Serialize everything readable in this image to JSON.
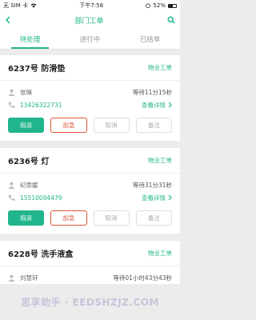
{
  "status_bar": {
    "carrier": "无 SIM 卡",
    "time": "下午7:58",
    "battery": "52%"
  },
  "nav": {
    "title": "部门工单"
  },
  "tabs": [
    {
      "label": "待处理"
    },
    {
      "label": "进行中"
    },
    {
      "label": "已结单"
    }
  ],
  "orders": [
    {
      "title": "6237号 防滑垫",
      "type": "物业工单",
      "person": "张琳",
      "wait": "等待11分15秒",
      "phone": "13426322731",
      "detail": "查看详情"
    },
    {
      "title": "6236号 灯",
      "type": "物业工单",
      "person": "纪思媛",
      "wait": "等待31分31秒",
      "phone": "15510094479",
      "detail": "查看详情"
    },
    {
      "title": "6228号 洗手液盒",
      "type": "物业工单",
      "person": "刘慧轩",
      "wait": "等待01小时43分43秒"
    }
  ],
  "buttons": {
    "assign": "指派",
    "urgent": "加急",
    "cancel": "取消",
    "remark": "备注"
  },
  "watermark": "思享助手 · EEDSHZJZ.COM",
  "colors": {
    "accent": "#21b58c",
    "urgent": "#e0553b"
  }
}
